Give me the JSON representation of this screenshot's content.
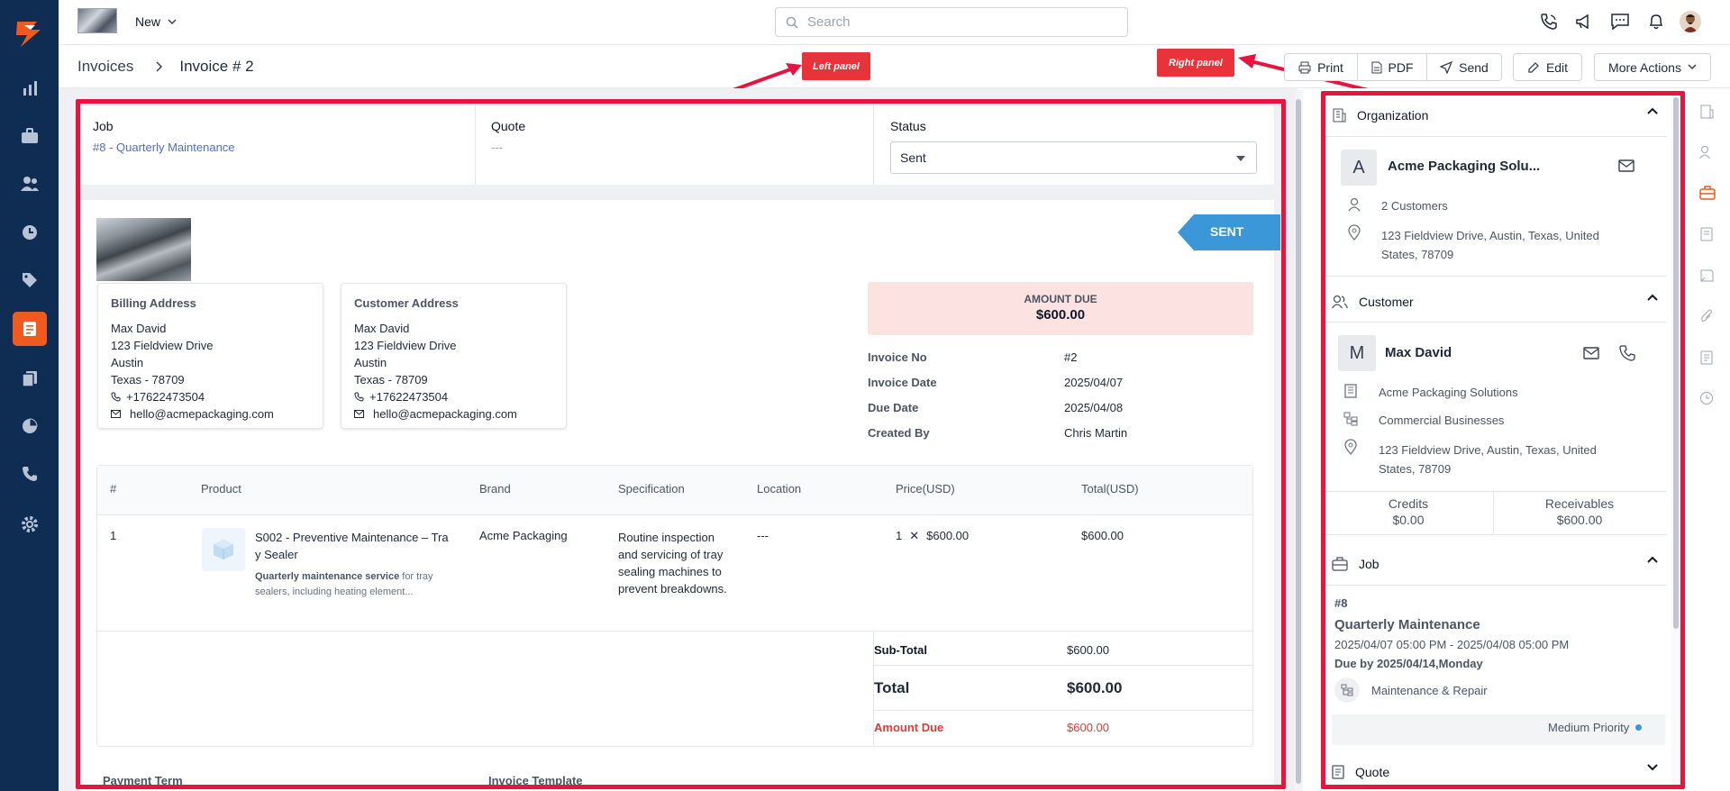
{
  "topbar": {
    "new_label": "New",
    "search_placeholder": "Search"
  },
  "breadcrumb": {
    "root": "Invoices",
    "current": "Invoice # 2"
  },
  "actions": {
    "print": "Print",
    "pdf": "PDF",
    "send": "Send",
    "edit": "Edit",
    "more": "More Actions"
  },
  "annotations": {
    "left": "Left panel",
    "right": "Right panel"
  },
  "summary": {
    "job_label": "Job",
    "job_value": "#8 - Quarterly Maintenance",
    "quote_label": "Quote",
    "quote_value": "---",
    "status_label": "Status",
    "status_value": "Sent"
  },
  "invoice": {
    "ribbon": "SENT",
    "billing": {
      "title": "Billing Address",
      "name": "Max David",
      "street": "123 Fieldview Drive",
      "city": "Austin",
      "state": "Texas - 78709",
      "phone": "+17622473504",
      "email": "hello@acmepackaging.com"
    },
    "customer_addr": {
      "title": "Customer Address",
      "name": "Max David",
      "street": "123 Fieldview Drive",
      "city": "Austin",
      "state": "Texas - 78709",
      "phone": "+17622473504",
      "email": "hello@acmepackaging.com"
    },
    "amount_due_label": "AMOUNT DUE",
    "amount_due_value": "$600.00",
    "meta": [
      {
        "label": "Invoice No",
        "value": "#2"
      },
      {
        "label": "Invoice Date",
        "value": "2025/04/07"
      },
      {
        "label": "Due Date",
        "value": "2025/04/08"
      },
      {
        "label": "Created By",
        "value": "Chris Martin"
      }
    ],
    "table": {
      "headers": [
        "#",
        "Product",
        "Brand",
        "Specification",
        "Location",
        "Price(USD)",
        "Total(USD)"
      ],
      "rows": [
        {
          "num": "1",
          "product_l1": "S002 - Preventive Maintenance – Tra",
          "product_l2": "y Sealer",
          "desc_bold": "Quarterly maintenance service",
          "desc_rest": " for tray",
          "desc_l2": "sealers, including heating element...",
          "brand": "Acme Packaging",
          "spec": [
            "Routine inspection",
            "and servicing of tray",
            "sealing machines to",
            "prevent breakdowns."
          ],
          "location": "---",
          "qty": "1",
          "times": "✕",
          "price": "$600.00",
          "total": "$600.00"
        }
      ]
    },
    "totals": {
      "subtotal_label": "Sub-Total",
      "subtotal": "$600.00",
      "total_label": "Total",
      "total": "$600.00",
      "due_label": "Amount Due",
      "due": "$600.00"
    },
    "footer": {
      "payment_term": "Payment Term",
      "template": "Invoice Template"
    }
  },
  "right": {
    "org": {
      "title": "Organization",
      "avatar": "A",
      "name": "Acme Packaging Solu...",
      "customers": "2 Customers",
      "addr1": "123 Fieldview Drive, Austin, Texas, United",
      "addr2": "States, 78709"
    },
    "customer": {
      "title": "Customer",
      "avatar": "M",
      "name": "Max David",
      "company": "Acme Packaging Solutions",
      "segment": "Commercial Businesses",
      "addr1": "123 Fieldview Drive, Austin, Texas, United",
      "addr2": "States, 78709",
      "credits_label": "Credits",
      "credits": "$0.00",
      "receivables_label": "Receivables",
      "receivables": "$600.00"
    },
    "job": {
      "title": "Job",
      "num": "#8",
      "name": "Quarterly Maintenance",
      "range": "2025/04/07 05:00 PM - 2025/04/08 05:00 PM",
      "due": "Due by 2025/04/14,Monday",
      "category": "Maintenance & Repair",
      "priority": "Medium Priority"
    },
    "quote": {
      "title": "Quote"
    }
  },
  "colors": {
    "nav": "#0f2d52",
    "accent": "#ef5a1f",
    "link": "#4f6bd8",
    "annotation": "#e8133f",
    "ribbon": "#3b97d8",
    "danger": "#e53935",
    "amount_bg": "#fde2e2"
  }
}
